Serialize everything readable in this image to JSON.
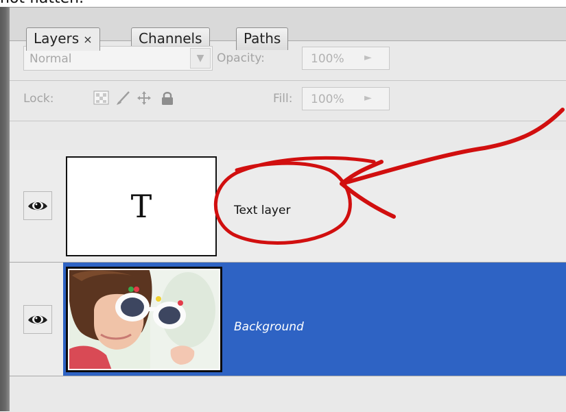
{
  "caption": "not flatten.",
  "tabs": [
    {
      "label": "Layers",
      "close": "×"
    },
    {
      "label": "Channels"
    },
    {
      "label": "Paths"
    }
  ],
  "blend_mode": {
    "value": "Normal"
  },
  "opacity": {
    "label": "Opacity:",
    "value": "100%"
  },
  "lock": {
    "label": "Lock:"
  },
  "fill": {
    "label": "Fill:",
    "value": "100%"
  },
  "layers": [
    {
      "name": "Text layer",
      "thumb_glyph": "T",
      "selected": false
    },
    {
      "name": "Background",
      "selected": true
    }
  ],
  "colors": {
    "selection": "#2e63c4",
    "annotation": "#d10f0f"
  }
}
